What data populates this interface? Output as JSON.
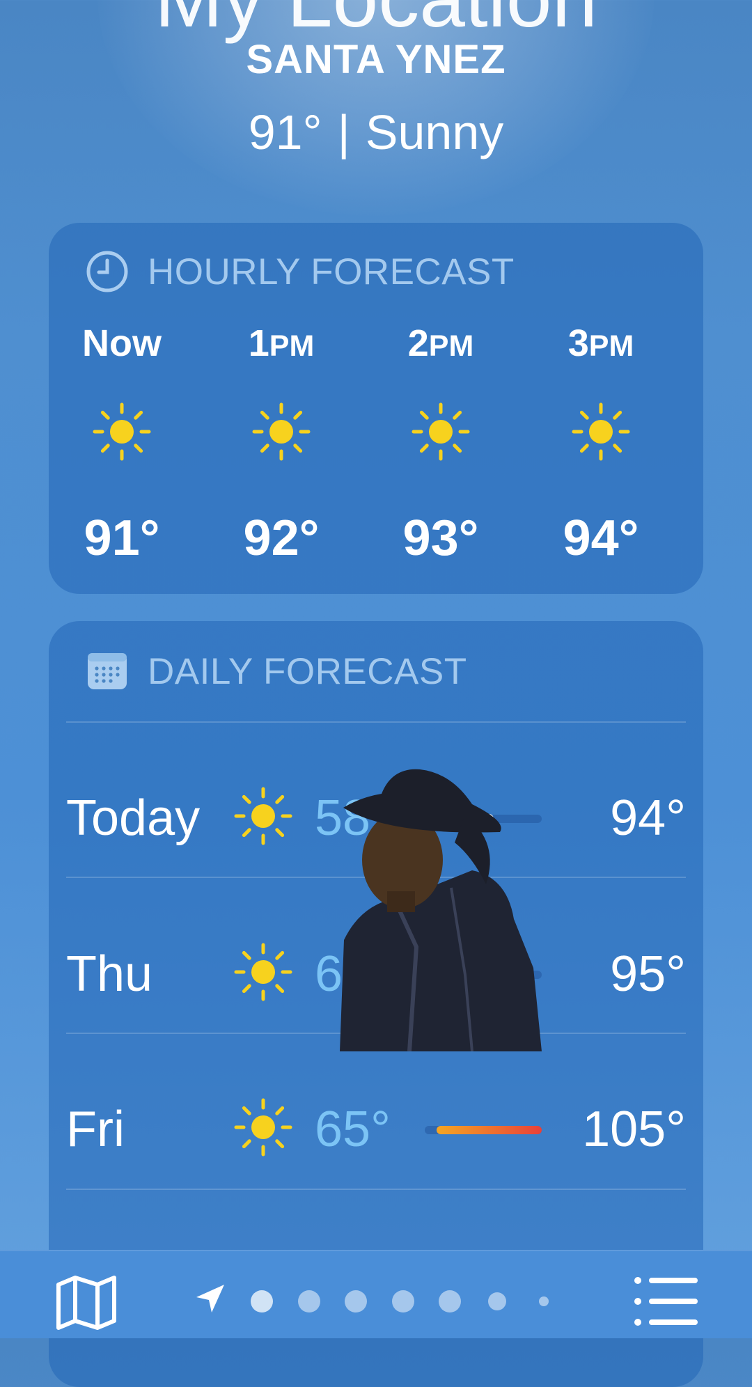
{
  "header": {
    "title": "My Location",
    "place": "SANTA YNEZ",
    "temperature": "91°",
    "separator": "|",
    "condition": "Sunny"
  },
  "hourly": {
    "title": "HOURLY FORECAST",
    "icon": "clock-icon",
    "items": [
      {
        "hour": "Now",
        "suffix": "",
        "icon": "sun-icon",
        "temp": "91°"
      },
      {
        "hour": "1",
        "suffix": "PM",
        "icon": "sun-icon",
        "temp": "92°"
      },
      {
        "hour": "2",
        "suffix": "PM",
        "icon": "sun-icon",
        "temp": "93°"
      },
      {
        "hour": "3",
        "suffix": "PM",
        "icon": "sun-icon",
        "temp": "94°"
      }
    ]
  },
  "daily": {
    "title": "DAILY FORECAST",
    "icon": "calendar-icon",
    "days": [
      {
        "day": "Today",
        "icon": "sun-icon",
        "low": "58°",
        "high": "94°",
        "range_start": 0.0,
        "range_end": 0.55,
        "current": 0.55
      },
      {
        "day": "Thu",
        "icon": "sun-icon",
        "low": "6",
        "high": "95°",
        "range_start": 0.1,
        "range_end": 0.6
      },
      {
        "day": "Fri",
        "icon": "sun-icon",
        "low": "65°",
        "high": "105°",
        "range_start": 0.1,
        "range_end": 1.0
      },
      {
        "day": "",
        "icon": "sun-icon",
        "low": "",
        "high": ""
      }
    ]
  },
  "bottom_bar": {
    "map_icon": "map-icon",
    "location_icon": "location-arrow-icon",
    "list_icon": "list-icon",
    "page_count": 7,
    "active_page": 0
  },
  "overlay": {
    "image": "cowboy-sticker"
  },
  "colors": {
    "sun": "#f7d21e",
    "low_temp": "#7cc4f5",
    "range_warm": "#f5a623",
    "range_hot": "#e8413a",
    "header_text": "#aacdf0"
  }
}
